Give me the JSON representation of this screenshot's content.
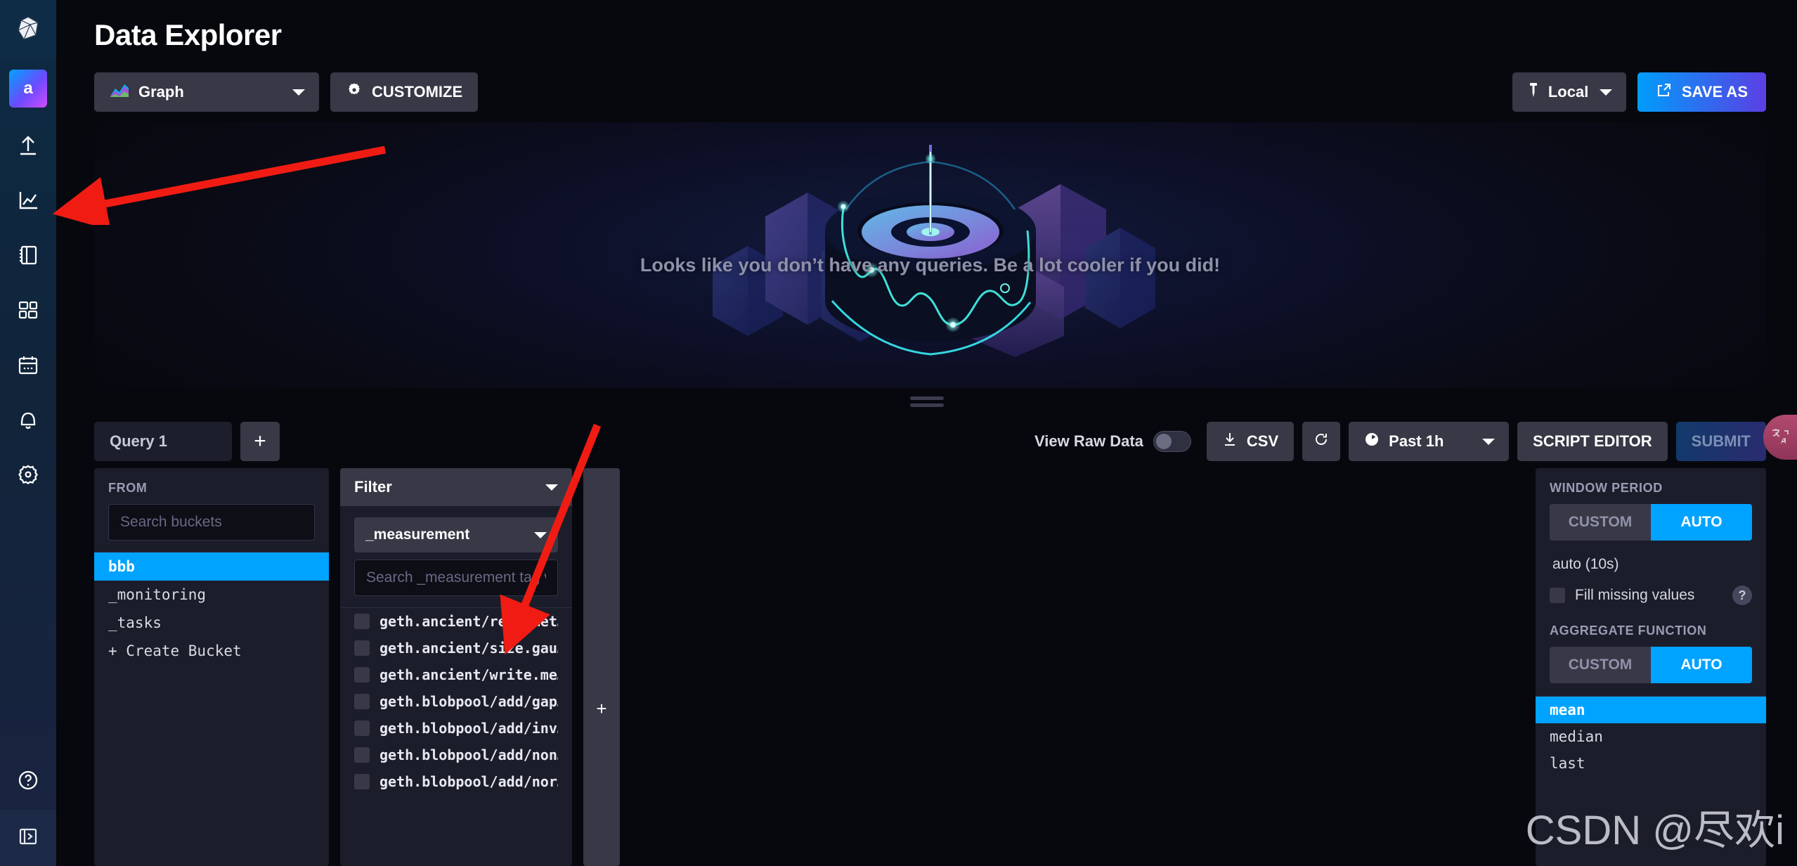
{
  "nav": {
    "logo_icon": "influxdb-logo-icon",
    "org_chip_label": "a",
    "items": [
      {
        "name": "load-data-icon",
        "label": "Load Data"
      },
      {
        "name": "data-explorer-icon",
        "label": "Explore"
      },
      {
        "name": "notebooks-icon",
        "label": "Notebooks"
      },
      {
        "name": "dashboards-icon",
        "label": "Dashboards"
      },
      {
        "name": "tasks-icon",
        "label": "Tasks"
      },
      {
        "name": "alerts-icon",
        "label": "Alerts"
      },
      {
        "name": "settings-icon",
        "label": "Settings"
      }
    ],
    "help_icon": "help-circle-icon",
    "collapse_icon": "expand-panel-icon",
    "active_index": 1
  },
  "header": {
    "title": "Data Explorer"
  },
  "viz_toolbar": {
    "viz_type": "Graph",
    "viz_type_icon": "graph-icon",
    "customize_label": "CUSTOMIZE",
    "customize_icon": "gear-icon",
    "pin_label": "Local",
    "pin_icon": "pin-icon",
    "save_as_label": "SAVE AS",
    "save_as_icon": "export-icon",
    "save_as_gradient_from": "#009dfa",
    "save_as_gradient_to": "#5b3fe4"
  },
  "viz_panel": {
    "empty_message": "Looks like you don’t have any queries. Be a lot cooler if you did!",
    "illustration": "isometric-data-cubes-illustration"
  },
  "query_toolbar": {
    "tabs": [
      {
        "label": "Query 1",
        "active": true
      }
    ],
    "add_query_label": "+",
    "view_raw_data_label": "View Raw Data",
    "view_raw_data_on": false,
    "csv_label": "CSV",
    "csv_icon": "download-icon",
    "refresh_icon": "refresh-icon",
    "time_range_label": "Past 1h",
    "time_range_icon": "clock-icon",
    "script_editor_label": "SCRIPT EDITOR",
    "submit_label": "SUBMIT",
    "submit_disabled": true
  },
  "from_panel": {
    "label": "FROM",
    "search_placeholder": "Search buckets",
    "search_value": "",
    "buckets": [
      {
        "label": "bbb",
        "selected": true
      },
      {
        "label": "_monitoring",
        "selected": false
      },
      {
        "label": "_tasks",
        "selected": false
      }
    ],
    "create_bucket_label": "+ Create Bucket"
  },
  "filter_panel": {
    "header_label": "Filter",
    "tag_key": "_measurement",
    "search_placeholder": "Search _measurement tag va",
    "search_value": "",
    "tag_values": [
      {
        "label": "geth.ancient/read.met…",
        "checked": false
      },
      {
        "label": "geth.ancient/size.gau…",
        "checked": false
      },
      {
        "label": "geth.ancient/write.me…",
        "checked": false
      },
      {
        "label": "geth.blobpool/add/gap…",
        "checked": false
      },
      {
        "label": "geth.blobpool/add/inv…",
        "checked": false
      },
      {
        "label": "geth.blobpool/add/non…",
        "checked": false
      },
      {
        "label": "geth.blobpool/add/nor…",
        "checked": false
      }
    ]
  },
  "add_card": {
    "label": "+"
  },
  "right_panel": {
    "window_period": {
      "label": "WINDOW PERIOD",
      "custom_label": "CUSTOM",
      "auto_label": "AUTO",
      "active": "AUTO",
      "auto_value": "auto (10s)",
      "fill_missing_label": "Fill missing values",
      "fill_missing_checked": false,
      "help_label": "?"
    },
    "aggregate_function": {
      "label": "AGGREGATE FUNCTION",
      "custom_label": "CUSTOM",
      "auto_label": "AUTO",
      "active": "AUTO",
      "functions": [
        {
          "label": "mean",
          "selected": true
        },
        {
          "label": "median",
          "selected": false
        },
        {
          "label": "last",
          "selected": false
        }
      ]
    }
  },
  "overlays": {
    "translate_tab_icon": "translate-icon",
    "watermark_text": "CSDN @尽欢i",
    "annotation_arrows": 2,
    "annotation_color": "#f01c13"
  },
  "colors": {
    "accent_blue": "#00a3ff",
    "panel_bg": "#1c1d2a",
    "page_bg": "#07080e",
    "button_bg": "#383846",
    "nav_bg_top": "#0c2b44"
  }
}
